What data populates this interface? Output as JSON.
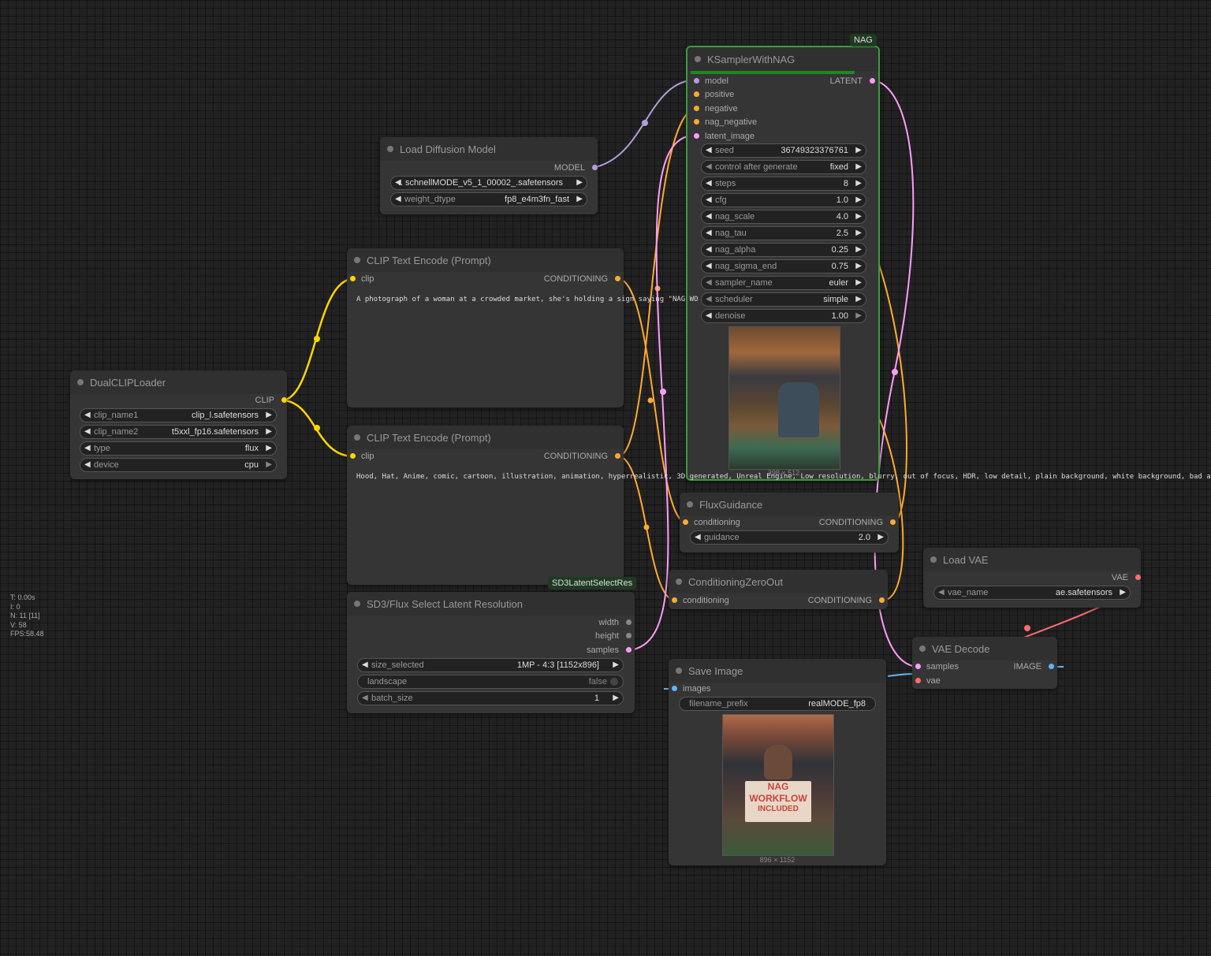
{
  "stats": {
    "t": "T: 0.00s",
    "i": "I: 0",
    "n": "N: 11 [11]",
    "v": "V: 58",
    "fps": "FPS:58.48"
  },
  "colors": {
    "clip": "#ffd500",
    "conditioning": "#ffa931",
    "model": "#b39ddb",
    "latent": "#ff9cf9",
    "vae": "#ff6e6e",
    "image": "#64b5f6",
    "nag_border": "#3c9d3c"
  },
  "nodes": {
    "ksampler": {
      "badge": "NAG",
      "title": "KSamplerWithNAG",
      "inputs": [
        "model",
        "positive",
        "negative",
        "nag_negative",
        "latent_image"
      ],
      "output": "LATENT",
      "widgets": [
        {
          "label": "seed",
          "value": "36749323376761"
        },
        {
          "label": "control after generate",
          "value": "fixed"
        },
        {
          "label": "steps",
          "value": "8"
        },
        {
          "label": "cfg",
          "value": "1.0"
        },
        {
          "label": "nag_scale",
          "value": "4.0"
        },
        {
          "label": "nag_tau",
          "value": "2.5"
        },
        {
          "label": "nag_alpha",
          "value": "0.25"
        },
        {
          "label": "nag_sigma_end",
          "value": "0.75"
        },
        {
          "label": "sampler_name",
          "value": "euler"
        },
        {
          "label": "scheduler",
          "value": "simple"
        },
        {
          "label": "denoise",
          "value": "1.00"
        }
      ],
      "preview_caption": "398 × 512",
      "preview_icon": "market-photo-preview"
    },
    "load_diffusion": {
      "title": "Load Diffusion Model",
      "output": "MODEL",
      "widgets": [
        {
          "label": "",
          "value": ".. schnellMODE_v5_1_00002_.safetensors"
        },
        {
          "label": "weight_dtype",
          "value": "fp8_e4m3fn_fast"
        }
      ]
    },
    "clip_text_1": {
      "title": "CLIP Text Encode (Prompt)",
      "input": "clip",
      "output": "CONDITIONING",
      "text": "A photograph of a woman at a crowded market, she's holding a sign saying \"NAG WO"
    },
    "clip_text_2": {
      "title": "CLIP Text Encode (Prompt)",
      "input": "clip",
      "output": "CONDITIONING",
      "text": "Hood,  Hat, Anime, comic, cartoon, illustration, animation, hyperrealistic, 3D generated, Unreal Engine, Low resolution, blurry, out of focus, HDR, low detail, plain background, white background, bad anato"
    },
    "dual_clip": {
      "title": "DualCLIPLoader",
      "output": "CLIP",
      "widgets": [
        {
          "label": "clip_name1",
          "value": "clip_l.safetensors"
        },
        {
          "label": "clip_name2",
          "value": "t5xxl_fp16.safetensors"
        },
        {
          "label": "type",
          "value": "flux"
        },
        {
          "label": "device",
          "value": "cpu"
        }
      ]
    },
    "flux_guidance": {
      "title": "FluxGuidance",
      "input": "conditioning",
      "output": "CONDITIONING",
      "widgets": [
        {
          "label": "guidance",
          "value": "2.0"
        }
      ]
    },
    "cond_zero": {
      "title": "ConditioningZeroOut",
      "input": "conditioning",
      "output": "CONDITIONING"
    },
    "sd3_latent": {
      "badge": "SD3LatentSelectRes",
      "title": "SD3/Flux Select Latent Resolution",
      "outputs": [
        "width",
        "height",
        "samples"
      ],
      "widgets": [
        {
          "label": "size_selected",
          "value": "1MP - 4:3 [1152x896]"
        },
        {
          "label": "landscape",
          "value": "false"
        },
        {
          "label": "batch_size",
          "value": "1"
        }
      ]
    },
    "load_vae": {
      "title": "Load VAE",
      "output": "VAE",
      "widgets": [
        {
          "label": "vae_name",
          "value": "ae.safetensors"
        }
      ]
    },
    "vae_decode": {
      "title": "VAE Decode",
      "inputs": [
        "samples",
        "vae"
      ],
      "output": "IMAGE"
    },
    "save_image": {
      "title": "Save Image",
      "input": "images",
      "widgets": [
        {
          "label": "filename_prefix",
          "value": "realMODE_fp8"
        }
      ],
      "image_caption": "896 × 1152",
      "sign_text": [
        "NAG",
        "WORKFLOW",
        "INCLUDED"
      ]
    }
  }
}
